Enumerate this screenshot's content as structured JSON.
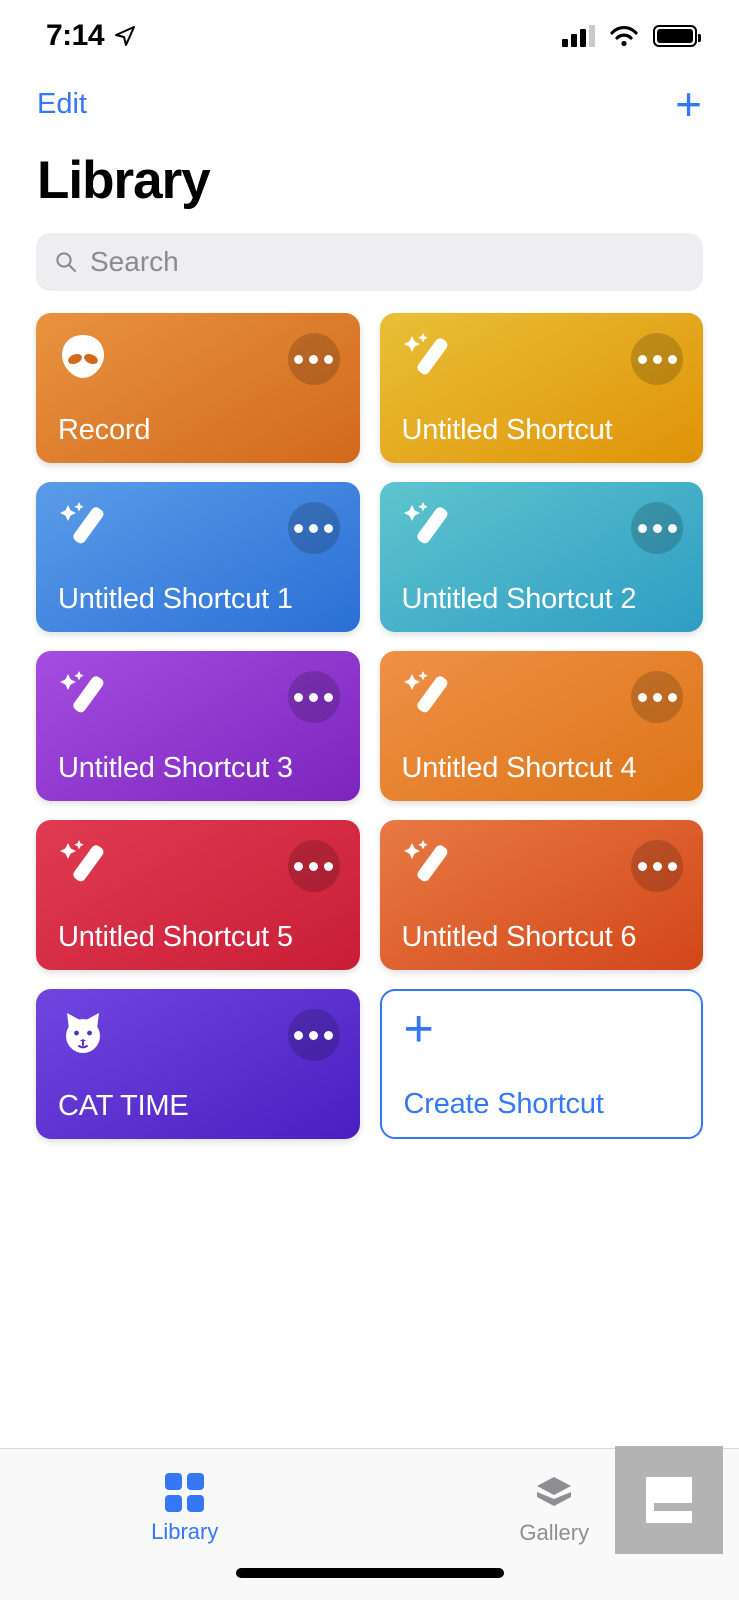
{
  "status_bar": {
    "time": "7:14",
    "location_icon": "location-arrow-icon",
    "cellular_icon": "cellular-bars-icon",
    "wifi_icon": "wifi-icon",
    "battery_icon": "battery-full-icon"
  },
  "navbar": {
    "edit_label": "Edit",
    "add_label": "+"
  },
  "header": {
    "title": "Library"
  },
  "search": {
    "placeholder": "Search",
    "value": "",
    "icon": "search-icon"
  },
  "colors": {
    "accent_blue": "#3478f6",
    "search_background": "#eeeef0",
    "inactive_gray": "#8e8e93",
    "tabbar_background": "#f9f9f9"
  },
  "shortcuts": [
    {
      "label": "Record",
      "icon": "alien-head-icon",
      "color_start": "#e8933f",
      "color_end": "#d2691c",
      "menu_label": "..."
    },
    {
      "label": "Untitled Shortcut",
      "icon": "magic-wand-icon",
      "color_start": "#e8c036",
      "color_end": "#e09208",
      "menu_label": "..."
    },
    {
      "label": "Untitled Shortcut 1",
      "icon": "magic-wand-icon",
      "color_start": "#5b9ce8",
      "color_end": "#2a6fd6",
      "menu_label": "..."
    },
    {
      "label": "Untitled Shortcut 2",
      "icon": "magic-wand-icon",
      "color_start": "#5ec4ce",
      "color_end": "#2f9dc4",
      "menu_label": "..."
    },
    {
      "label": "Untitled Shortcut 3",
      "icon": "magic-wand-icon",
      "color_start": "#a44de0",
      "color_end": "#7c25be",
      "menu_label": "..."
    },
    {
      "label": "Untitled Shortcut 4",
      "icon": "magic-wand-icon",
      "color_start": "#ef9046",
      "color_end": "#dd7518",
      "menu_label": "..."
    },
    {
      "label": "Untitled Shortcut 5",
      "icon": "magic-wand-icon",
      "color_start": "#e03b52",
      "color_end": "#c91d36",
      "menu_label": "..."
    },
    {
      "label": "Untitled Shortcut 6",
      "icon": "magic-wand-icon",
      "color_start": "#e87a44",
      "color_end": "#d34619",
      "menu_label": "..."
    },
    {
      "label": "CAT TIME",
      "icon": "cat-face-icon",
      "color_start": "#7045e0",
      "color_end": "#4a1fc0",
      "menu_label": "..."
    }
  ],
  "create_card": {
    "label": "Create Shortcut",
    "plus": "+",
    "icon": "plus-icon"
  },
  "tabbar": {
    "tabs": [
      {
        "label": "Library",
        "icon": "grid-squares-icon",
        "active": true
      },
      {
        "label": "Gallery",
        "icon": "layers-stack-icon",
        "active": false
      }
    ]
  },
  "watermark": {
    "letter": "e"
  }
}
